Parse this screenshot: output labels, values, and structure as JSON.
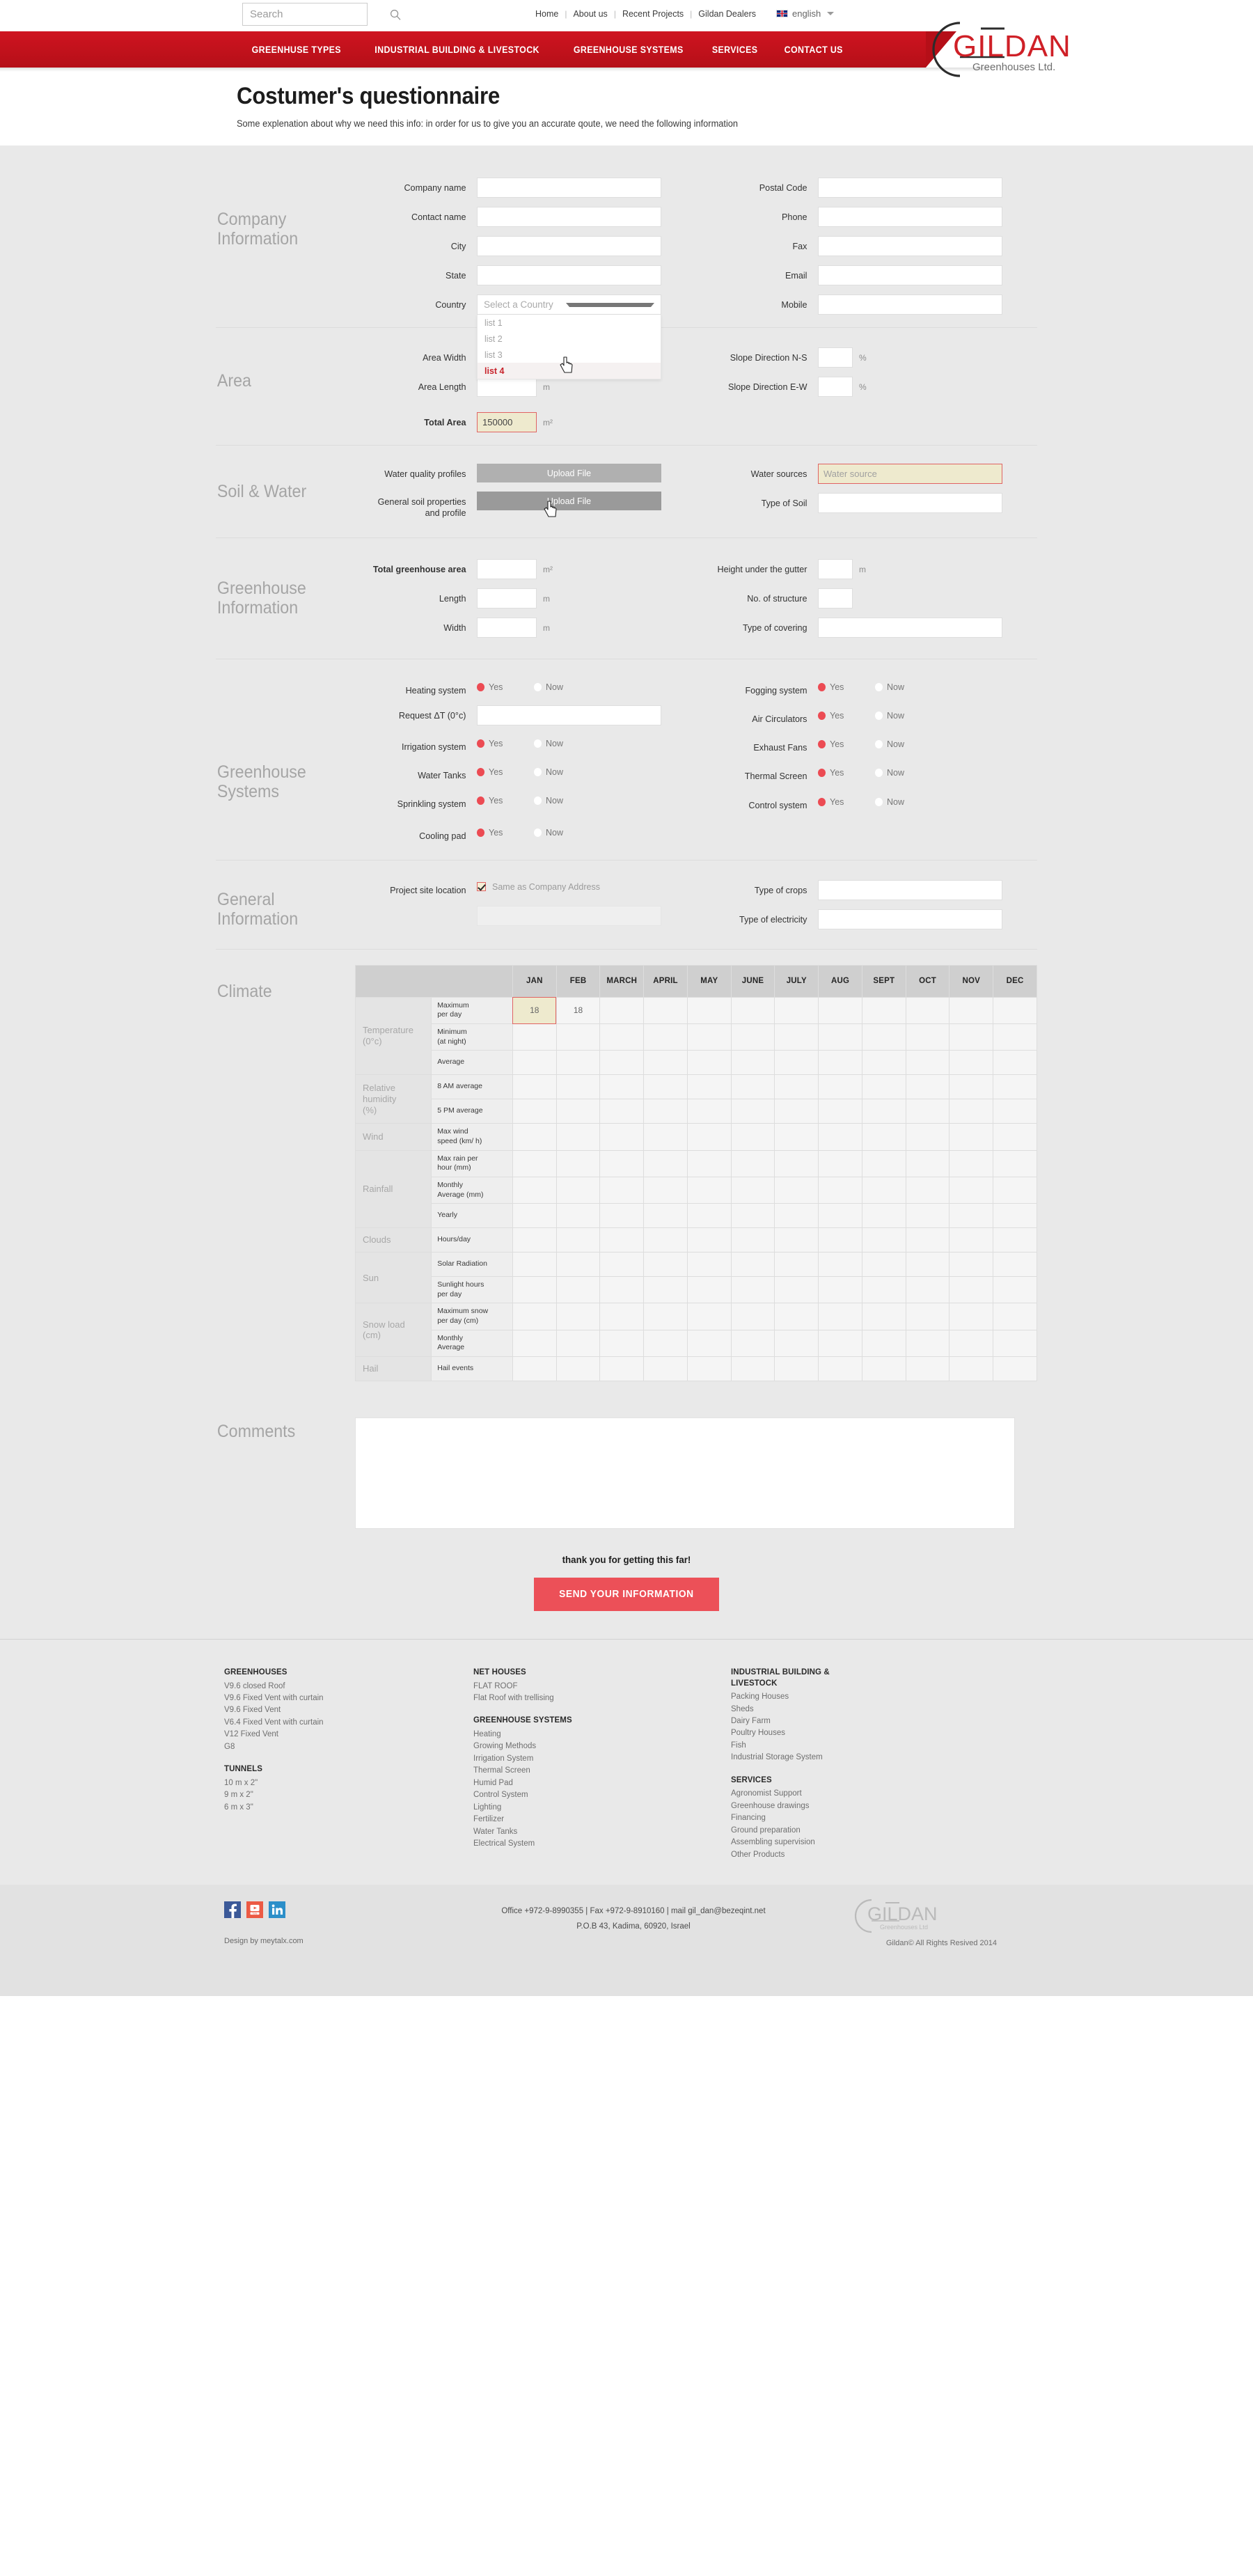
{
  "header": {
    "search": {
      "placeholder": "Search",
      "icon": "search-icon"
    },
    "top_links": [
      "Home",
      "About us",
      "Recent Projects",
      "Gildan Dealers"
    ],
    "language": "english",
    "nav": [
      "GREENHUSE TYPES",
      "INDUSTRIAL BUILDING & LIVESTOCK",
      "GREENHOUSE SYSTEMS",
      "SERVICES",
      "CONTACT US"
    ],
    "logo_main": "GILDAN",
    "logo_sub": "Greenhouses Ltd."
  },
  "page": {
    "title": "Costumer's questionnaire",
    "subtitle": "Some explenation about why we need this info: in order for us to give you an accurate qoute, we need the following information"
  },
  "company": {
    "section_title": "Company\nInformation",
    "left": [
      {
        "label": "Company name",
        "value": ""
      },
      {
        "label": "Contact name",
        "value": ""
      },
      {
        "label": "City",
        "value": ""
      },
      {
        "label": "State",
        "value": ""
      }
    ],
    "country_label": "Country",
    "country_placeholder": "Select a Country",
    "country_options": [
      "list 1",
      "list 2",
      "list 3",
      "list 4"
    ],
    "country_selected_highlight": "list 4",
    "right": [
      {
        "label": "Postal Code",
        "value": ""
      },
      {
        "label": "Phone",
        "value": ""
      },
      {
        "label": "Fax",
        "value": ""
      },
      {
        "label": "Email",
        "value": ""
      },
      {
        "label": "Mobile",
        "value": ""
      }
    ]
  },
  "area": {
    "section_title": "Area",
    "width_label": "Area Width",
    "width_value": "",
    "length_label": "Area Length",
    "length_value": "",
    "length_unit": "m",
    "total_label": "Total Area",
    "total_value": "150000",
    "total_unit": "m²",
    "slope_ns_label": "Slope Direction N-S",
    "slope_ns_value": "",
    "slope_ew_label": "Slope Direction E-W",
    "slope_ew_value": "",
    "percent_unit": "%"
  },
  "soil": {
    "section_title": "Soil & Water",
    "water_quality_label": "Water quality profiles",
    "soil_props_label": "General soil properties\nand profile",
    "upload_label": "Upload File",
    "water_sources_label": "Water sources",
    "water_sources_placeholder": "Water source",
    "type_of_soil_label": "Type of Soil",
    "type_of_soil_value": ""
  },
  "greenhouse_info": {
    "section_title": "Greenhouse\nInformation",
    "left": [
      {
        "label": "Total greenhouse area",
        "value": "",
        "unit": "m²",
        "bold": true
      },
      {
        "label": "Length",
        "value": "",
        "unit": "m",
        "bold": false
      },
      {
        "label": "Width",
        "value": "",
        "unit": "m",
        "bold": false
      }
    ],
    "right": [
      {
        "label": "Height under the gutter",
        "value": "",
        "unit": "m"
      },
      {
        "label": "No. of structure",
        "value": "",
        "unit": ""
      },
      {
        "label": "Type of covering",
        "value": "",
        "unit": ""
      }
    ]
  },
  "greenhouse_systems": {
    "section_title": "Greenhouse\nSystems",
    "yes_label": "Yes",
    "no_label": "Now",
    "left": [
      {
        "label": "Heating system",
        "selected": "yes"
      },
      {
        "label": "Irrigation system",
        "selected": "yes"
      },
      {
        "label": "Water Tanks",
        "selected": "yes"
      },
      {
        "label": "Sprinkling system",
        "selected": "yes"
      },
      {
        "label": "Cooling pad",
        "selected": "yes"
      }
    ],
    "right": [
      {
        "label": "Fogging system",
        "selected": "yes"
      },
      {
        "label": "Air Circulators",
        "selected": "yes"
      },
      {
        "label": "Exhaust Fans",
        "selected": "yes"
      },
      {
        "label": "Thermal Screen",
        "selected": "yes"
      },
      {
        "label": "Control system",
        "selected": "yes"
      }
    ],
    "delta_label": "Request ΔT (0°c)",
    "delta_value": ""
  },
  "general_info": {
    "section_title": "General\nInformation",
    "project_site_label": "Project site location",
    "same_address_label": "Same as Company Address",
    "same_address_checked": true,
    "address_value": "",
    "crops_label": "Type of crops",
    "crops_value": "",
    "electricity_label": "Type of electricity",
    "electricity_value": ""
  },
  "climate": {
    "section_title": "Climate",
    "months": [
      "JAN",
      "FEB",
      "MARCH",
      "APRIL",
      "MAY",
      "JUNE",
      "JULY",
      "AUG",
      "SEPT",
      "OCT",
      "NOV",
      "DEC"
    ],
    "groups": [
      {
        "name": "Temperature\n(0°c)",
        "rows": [
          {
            "sub": "Maximum\nper day",
            "values": [
              "18",
              "18",
              "",
              "",
              "",
              "",
              "",
              "",
              "",
              "",
              "",
              ""
            ],
            "active_col": 0
          },
          {
            "sub": "Minimum\n(at night)",
            "values": [
              "",
              "",
              "",
              "",
              "",
              "",
              "",
              "",
              "",
              "",
              "",
              ""
            ],
            "active_col": -1
          },
          {
            "sub": "Average",
            "values": [
              "",
              "",
              "",
              "",
              "",
              "",
              "",
              "",
              "",
              "",
              "",
              ""
            ],
            "active_col": -1
          }
        ]
      },
      {
        "name": "Relative\n humidity\n(%)",
        "rows": [
          {
            "sub": "8 AM average",
            "values": [
              "",
              "",
              "",
              "",
              "",
              "",
              "",
              "",
              "",
              "",
              "",
              ""
            ],
            "active_col": -1
          },
          {
            "sub": "5 PM average",
            "values": [
              "",
              "",
              "",
              "",
              "",
              "",
              "",
              "",
              "",
              "",
              "",
              ""
            ],
            "active_col": -1
          }
        ]
      },
      {
        "name": "Wind",
        "rows": [
          {
            "sub": "Max wind\nspeed (km/ h)",
            "values": [
              "",
              "",
              "",
              "",
              "",
              "",
              "",
              "",
              "",
              "",
              "",
              ""
            ],
            "active_col": -1
          }
        ]
      },
      {
        "name": "Rainfall",
        "rows": [
          {
            "sub": "Max rain per\nhour (mm)",
            "values": [
              "",
              "",
              "",
              "",
              "",
              "",
              "",
              "",
              "",
              "",
              "",
              ""
            ],
            "active_col": -1
          },
          {
            "sub": "Monthly\nAverage (mm)",
            "values": [
              "",
              "",
              "",
              "",
              "",
              "",
              "",
              "",
              "",
              "",
              "",
              ""
            ],
            "active_col": -1
          },
          {
            "sub": "Yearly",
            "values": [
              "",
              "",
              "",
              "",
              "",
              "",
              "",
              "",
              "",
              "",
              "",
              ""
            ],
            "active_col": -1
          }
        ]
      },
      {
        "name": "Clouds",
        "rows": [
          {
            "sub": "Hours/day",
            "values": [
              "",
              "",
              "",
              "",
              "",
              "",
              "",
              "",
              "",
              "",
              "",
              ""
            ],
            "active_col": -1
          }
        ]
      },
      {
        "name": "Sun",
        "rows": [
          {
            "sub": "Solar Radiation",
            "values": [
              "",
              "",
              "",
              "",
              "",
              "",
              "",
              "",
              "",
              "",
              "",
              ""
            ],
            "active_col": -1
          },
          {
            "sub": "Sunlight hours\nper day",
            "values": [
              "",
              "",
              "",
              "",
              "",
              "",
              "",
              "",
              "",
              "",
              "",
              ""
            ],
            "active_col": -1
          }
        ]
      },
      {
        "name": "Snow load\n(cm)",
        "rows": [
          {
            "sub": "Maximum snow\nper day (cm)",
            "values": [
              "",
              "",
              "",
              "",
              "",
              "",
              "",
              "",
              "",
              "",
              "",
              ""
            ],
            "active_col": -1
          },
          {
            "sub": "Monthly\nAverage",
            "values": [
              "",
              "",
              "",
              "",
              "",
              "",
              "",
              "",
              "",
              "",
              "",
              ""
            ],
            "active_col": -1
          }
        ]
      },
      {
        "name": "Hail",
        "rows": [
          {
            "sub": "Hail  events",
            "values": [
              "",
              "",
              "",
              "",
              "",
              "",
              "",
              "",
              "",
              "",
              "",
              ""
            ],
            "active_col": -1
          }
        ]
      }
    ]
  },
  "comments": {
    "section_title": "Comments",
    "value": ""
  },
  "submit": {
    "thanks": "thank you for getting this far!",
    "button_label": "SEND YOUR INFORMATION"
  },
  "footer": {
    "col1": [
      {
        "head": "GREENHOUSES",
        "items": [
          "V9.6 closed Roof",
          "V9.6 Fixed Vent with curtain",
          "V9.6 Fixed Vent",
          "V6.4 Fixed Vent with curtain",
          "V12 Fixed Vent",
          "G8"
        ]
      },
      {
        "head": "TUNNELS",
        "items": [
          "10 m x 2\"",
          "9 m x 2\"",
          "6 m x 3\""
        ]
      }
    ],
    "col2": [
      {
        "head": "NET HOUSES",
        "items": [
          "FLAT ROOF",
          "Flat Roof with trellising"
        ]
      },
      {
        "head": "GREENHOUSE SYSTEMS",
        "items": [
          "Heating",
          "Growing Methods",
          "Irrigation System",
          "Thermal Screen",
          "Humid Pad",
          "Control System",
          "Lighting",
          "Fertilizer",
          "Water Tanks",
          "Electrical System"
        ]
      }
    ],
    "col3": [
      {
        "head": "INDUSTRIAL BUILDING &\nLIVESTOCK",
        "items": [
          "Packing Houses",
          "Sheds",
          "Dairy Farm",
          "Poultry Houses",
          "Fish",
          "Industrial Storage System"
        ]
      },
      {
        "head": "SERVICES",
        "items": [
          "Agronomist Support",
          "Greenhouse drawings",
          "Financing",
          "Ground preparation",
          "Assembling supervision",
          "Other Products"
        ]
      }
    ],
    "socials": [
      "facebook-icon",
      "youtube-icon",
      "linkedin-icon"
    ],
    "contact_line1": "Office +972-9-8990355 | Fax  +972-9-8910160 | mail   gil_dan@bezeqint.net",
    "contact_line2": "P.O.B 43, Kadima, 60920, Israel",
    "design_prefix": "Design by ",
    "design_link": "meytalx.com",
    "rights": "Gildan© All Rights Resived 2014",
    "logo_main": "GILDAN",
    "logo_sub": "Greenhouses Ltd"
  }
}
